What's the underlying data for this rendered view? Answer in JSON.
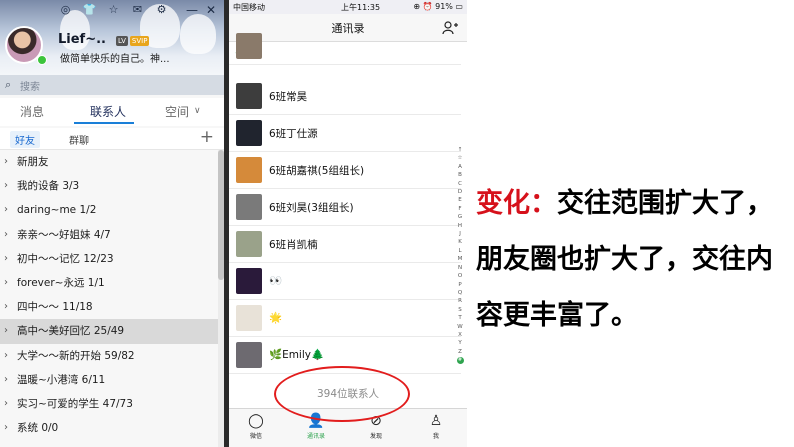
{
  "qq": {
    "nickname": "Lief~..",
    "badges": [
      "LV",
      "SVIP"
    ],
    "signature": "做简单快乐的自己。神...",
    "search_placeholder": "搜索",
    "tabs": [
      "消息",
      "联系人",
      "空间"
    ],
    "active_tab": "联系人",
    "subtabs": [
      "好友",
      "群聊"
    ],
    "groups": [
      {
        "label": "新朋友"
      },
      {
        "label": "我的设备 3/3"
      },
      {
        "label": "daring~me 1/2"
      },
      {
        "label": "亲亲～～好姐妹 4/7"
      },
      {
        "label": "初中～～记忆 12/23"
      },
      {
        "label": "forever~永远 1/1"
      },
      {
        "label": "四中～～ 11/18"
      },
      {
        "label": "高中～美好回忆 25/49",
        "highlight": true
      },
      {
        "label": "大学～～新的开始 59/82"
      },
      {
        "label": "温暖~小港湾 6/11"
      },
      {
        "label": "实习~可爱的学生 47/73"
      },
      {
        "label": "系统 0/0"
      }
    ]
  },
  "phone": {
    "carrier": "中国移动",
    "time": "上午11:35",
    "battery": "91%",
    "title": "通讯录",
    "section": "#",
    "contacts": [
      {
        "name": "",
        "color": "#8a7a6a"
      },
      {
        "name": "6班常昊",
        "color": "#3d3d3d"
      },
      {
        "name": "6班丁仕源",
        "color": "#20242e"
      },
      {
        "name": "6班胡嘉祺(5组组长)",
        "color": "#d58a3a"
      },
      {
        "name": "6班刘昊(3组组长)",
        "color": "#7a7a7a"
      },
      {
        "name": "6班肖凯楠",
        "color": "#9aa28a"
      },
      {
        "name": "👀",
        "color": "#2a1a3a"
      },
      {
        "name": "🌟",
        "color": "#e8e2d8"
      },
      {
        "name": "🌿Emily🌲",
        "color": "#6d6a70"
      }
    ],
    "index_letters": [
      "↑",
      "☆",
      "A",
      "B",
      "C",
      "D",
      "E",
      "F",
      "G",
      "H",
      "J",
      "K",
      "L",
      "M",
      "N",
      "O",
      "P",
      "Q",
      "R",
      "S",
      "T",
      "W",
      "X",
      "Y",
      "Z",
      "#"
    ],
    "contact_count": "394位联系人",
    "tabbar": [
      {
        "label": "微信",
        "icon": "chat-icon",
        "glyph": "◯"
      },
      {
        "label": "通讯录",
        "icon": "contacts-icon",
        "glyph": "👤",
        "active": true
      },
      {
        "label": "发现",
        "icon": "compass-icon",
        "glyph": "⊘"
      },
      {
        "label": "我",
        "icon": "person-icon",
        "glyph": "♙"
      }
    ]
  },
  "caption": {
    "highlight": "变化：",
    "text": "交往范围扩大了，朋友圈也扩大了，交往内容更丰富了。"
  },
  "colors": {
    "accent_red": "#d6111b",
    "wechat_green": "#2fa44f",
    "qq_blue": "#1a7fd8"
  }
}
